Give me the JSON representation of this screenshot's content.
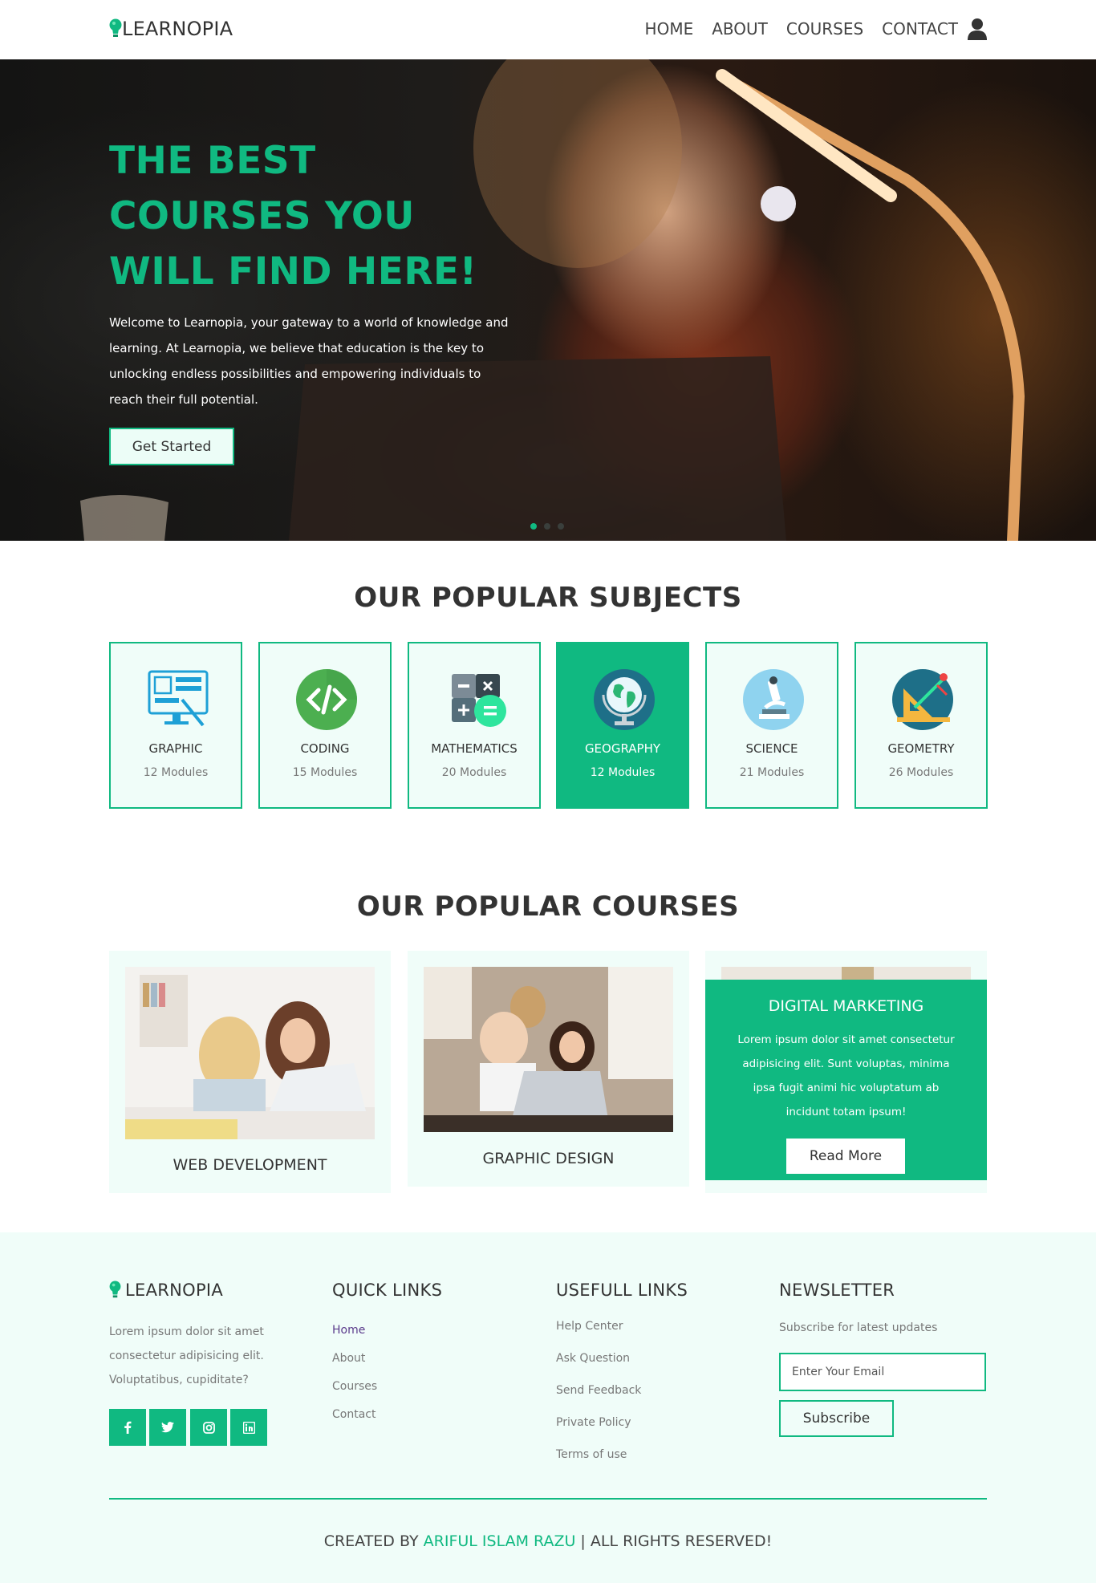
{
  "brand": {
    "name": "LEARNOPIA",
    "accent": "#10b981",
    "icon": "lightbulb-icon"
  },
  "nav": {
    "links": [
      "HOME",
      "ABOUT",
      "COURSES",
      "CONTACT"
    ],
    "user_icon": "user-icon"
  },
  "hero": {
    "title": "THE BEST COURSES YOU WILL FIND HERE!",
    "text": "Welcome to Learnopia, your gateway to a world of knowledge and learning. At Learnopia, we believe that education is the key to unlocking endless possibilities and empowering individuals to reach their full potential.",
    "button": "Get Started",
    "slides_total": 3,
    "slide_active": 1
  },
  "subjects": {
    "title": "OUR POPULAR SUBJECTS",
    "items": [
      {
        "name": "GRAPHIC",
        "modules": "12 Modules",
        "icon": "graphic-design-icon"
      },
      {
        "name": "CODING",
        "modules": "15 Modules",
        "icon": "code-icon"
      },
      {
        "name": "MATHEMATICS",
        "modules": "20 Modules",
        "icon": "calculator-icon"
      },
      {
        "name": "GEOGRAPHY",
        "modules": "12 Modules",
        "icon": "globe-icon",
        "active": true
      },
      {
        "name": "SCIENCE",
        "modules": "21 Modules",
        "icon": "microscope-icon"
      },
      {
        "name": "GEOMETRY",
        "modules": "26 Modules",
        "icon": "ruler-compass-icon"
      }
    ]
  },
  "courses": {
    "title": "OUR POPULAR COURSES",
    "items": [
      {
        "title": "WEB DEVELOPMENT"
      },
      {
        "title": "GRAPHIC DESIGN"
      },
      {
        "title": "DIGITAL MARKETING",
        "text": "Lorem ipsum dolor sit amet consectetur adipisicing elit. Sunt voluptas, minima ipsa fugit animi hic voluptatum ab incidunt totam ipsum!",
        "button": "Read More"
      }
    ]
  },
  "footer": {
    "brand": "LEARNOPIA",
    "about": "Lorem ipsum dolor sit amet consectetur adipisicing elit. Voluptatibus, cupiditate?",
    "social": [
      "facebook-icon",
      "twitter-icon",
      "instagram-icon",
      "linkedin-icon"
    ],
    "quick_links": {
      "title": "QUICK LINKS",
      "items": [
        "Home",
        "About",
        "Courses",
        "Contact"
      ]
    },
    "useful_links": {
      "title": "USEFULL LINKS",
      "items": [
        "Help Center",
        "Ask Question",
        "Send Feedback",
        "Private Policy",
        "Terms of use"
      ]
    },
    "newsletter": {
      "title": "NEWSLETTER",
      "subtitle": "Subscribe for latest updates",
      "placeholder": "Enter Your Email",
      "button": "Subscribe"
    },
    "copyright": {
      "prefix": "CREATED BY",
      "author": "ARIFUL ISLAM RAZU",
      "suffix": "| ALL RIGHTS RESERVED!"
    }
  }
}
